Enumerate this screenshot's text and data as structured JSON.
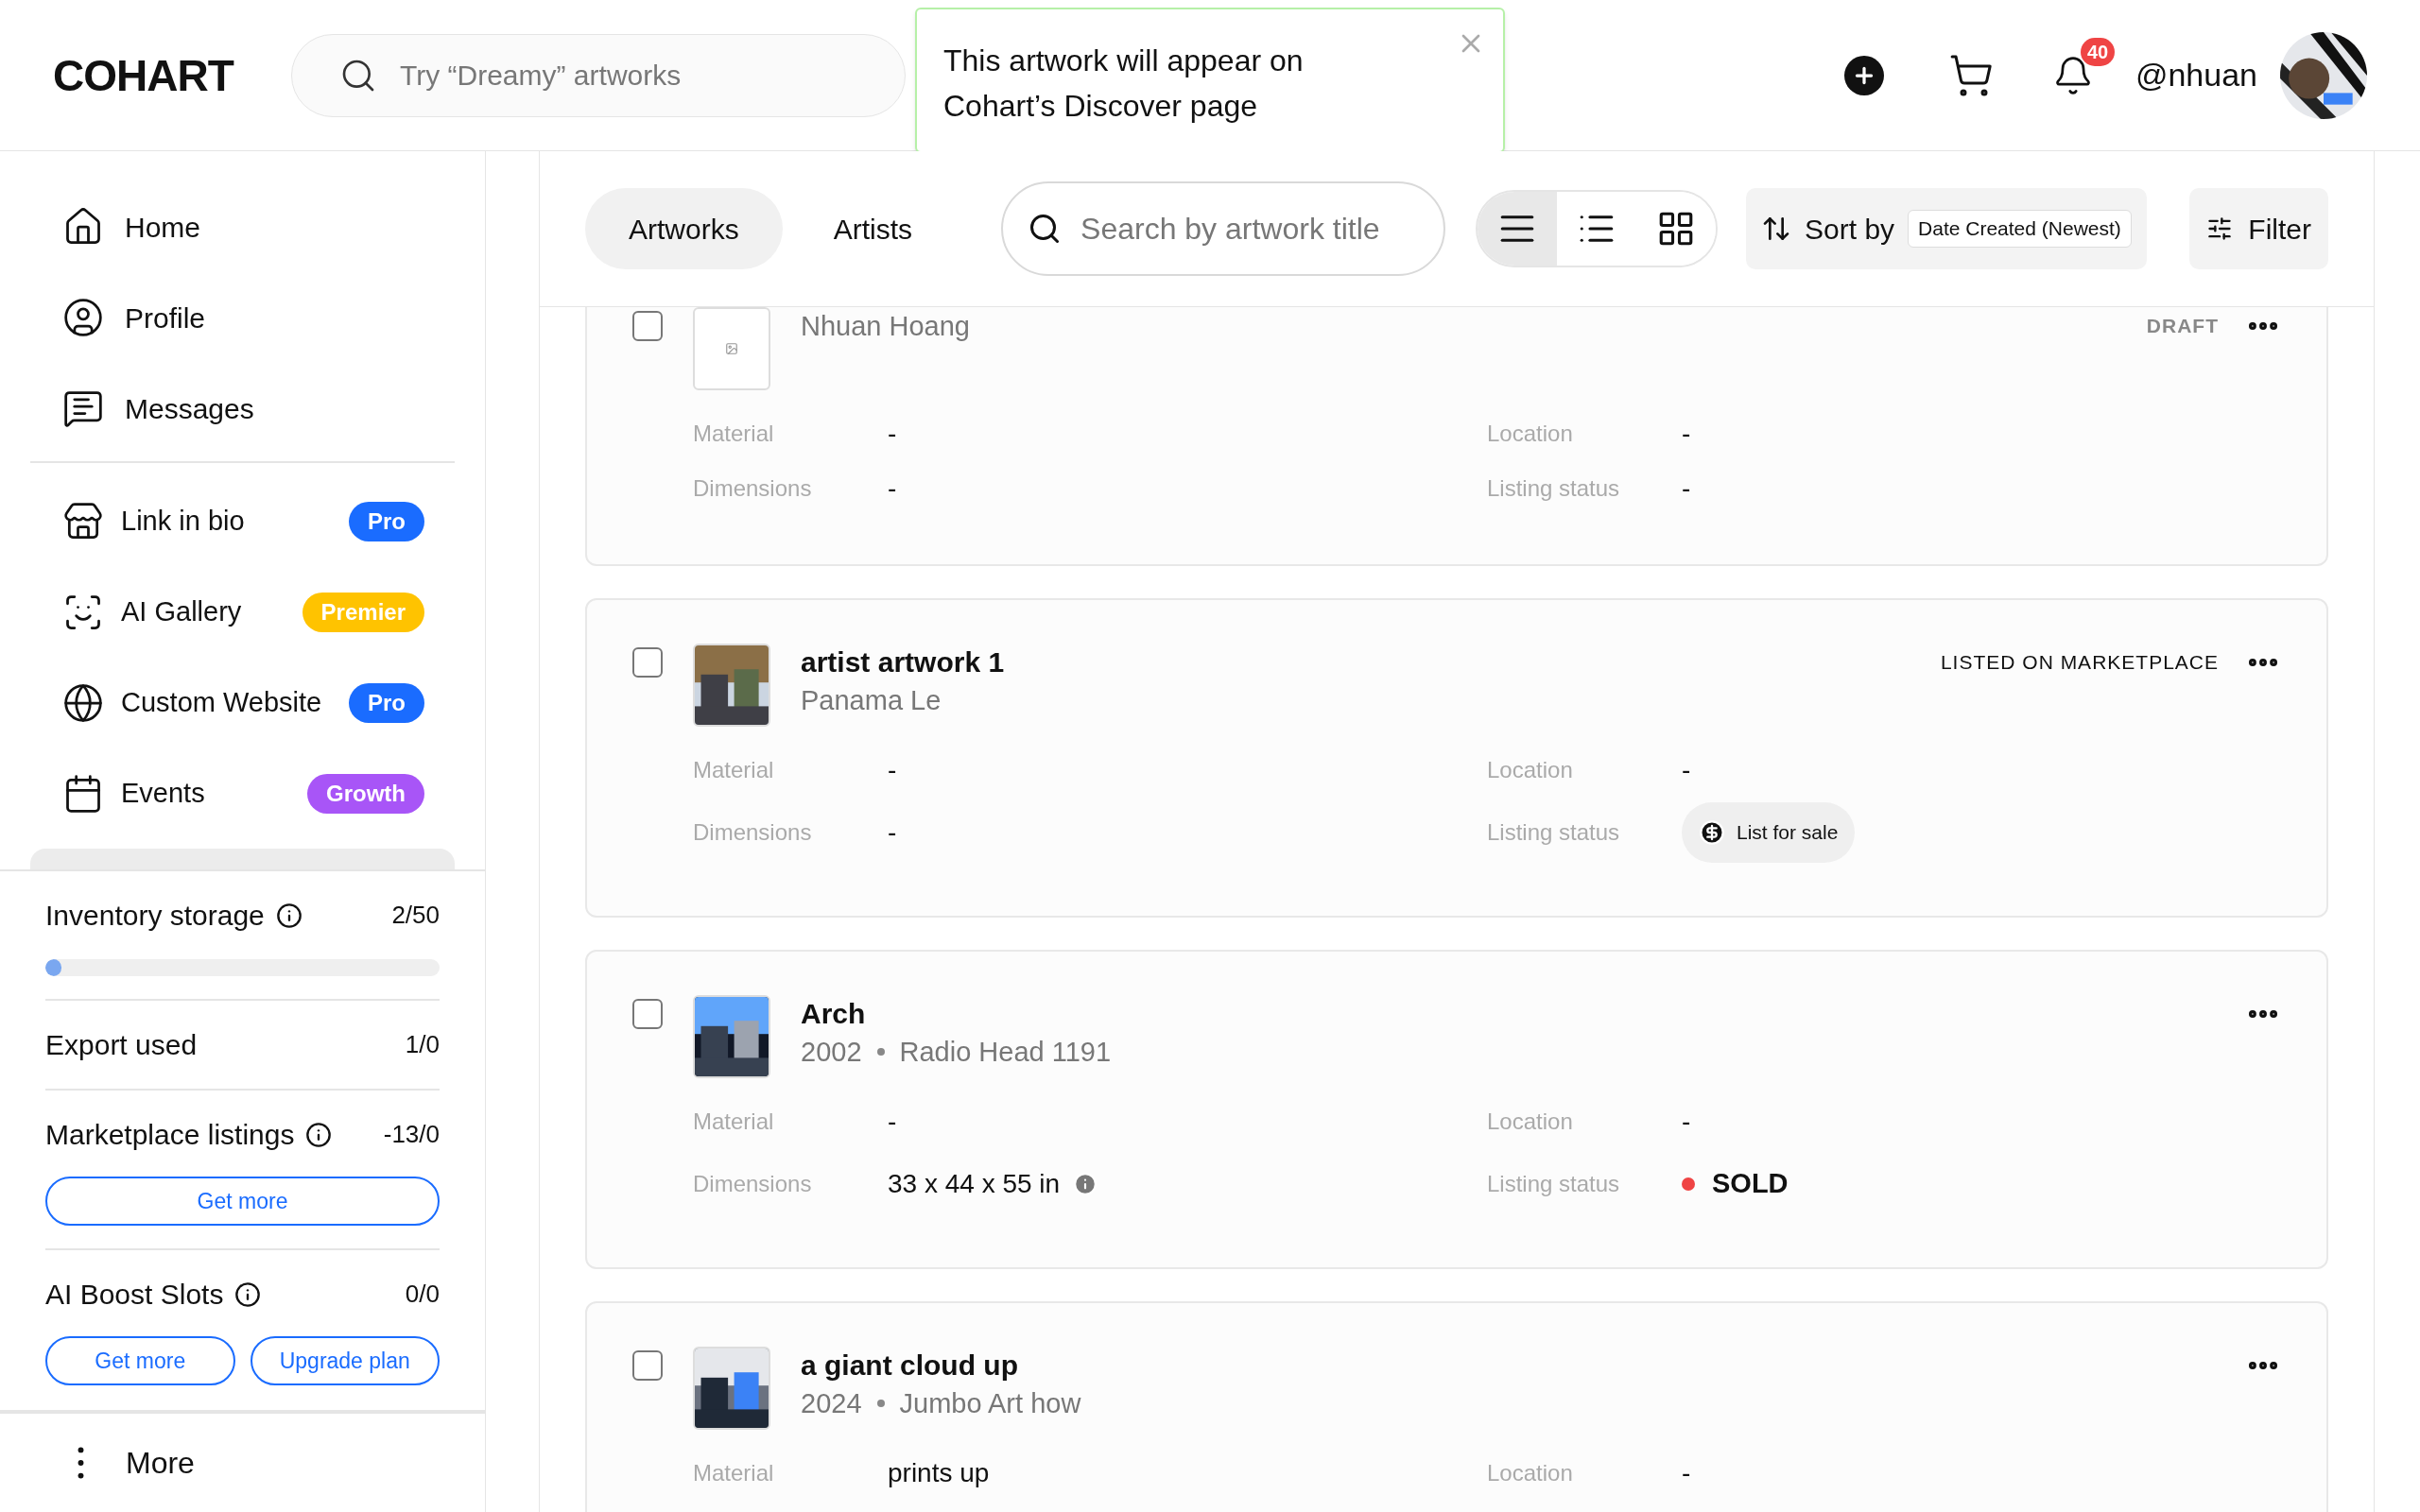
{
  "header": {
    "logo": "COHART",
    "search": {
      "placeholder": "Try “Dreamy” artworks"
    },
    "notifications": "40",
    "username": "@nhuan"
  },
  "toast": {
    "message": "This artwork will appear on Cohart’s Discover page"
  },
  "sidebar": {
    "nav": [
      {
        "label": "Home"
      },
      {
        "label": "Profile"
      },
      {
        "label": "Messages"
      }
    ],
    "features": [
      {
        "label": "Link in bio",
        "badge": "Pro",
        "color": "#1a6cff"
      },
      {
        "label": "AI Gallery",
        "badge": "Premier",
        "color": "#ffc300"
      },
      {
        "label": "Custom Website",
        "badge": "Pro",
        "color": "#1a6cff"
      },
      {
        "label": "Events",
        "badge": "Growth",
        "color": "#a855f7"
      }
    ],
    "usage": [
      {
        "label": "Inventory storage",
        "info": true,
        "value": "2/50",
        "level": 0.04
      },
      {
        "label": "Export used",
        "value": "1/0"
      },
      {
        "label": "Marketplace listings",
        "info": true,
        "value": "-13/0",
        "buttons": [
          "Get more"
        ]
      },
      {
        "label": "AI Boost Slots",
        "info": true,
        "value": "0/0",
        "buttons": [
          "Get more",
          "Upgrade plan"
        ]
      }
    ],
    "more": "More"
  },
  "toolbar": {
    "tabs": [
      {
        "label": "Artworks",
        "selected": true
      },
      {
        "label": "Artists",
        "selected": false
      }
    ],
    "search": {
      "placeholder": "Search by artwork title"
    },
    "views": [
      {
        "selected": true
      },
      {
        "selected": false
      },
      {
        "selected": false
      }
    ],
    "sort_label": "Sort by",
    "sort_value": "Date Created (Newest)",
    "filter": "Filter"
  },
  "artworks": [
    {
      "subtitle": [
        "Nhuan Hoang"
      ],
      "image": {
        "kind": "placeholder"
      },
      "status": {
        "text": "DRAFT",
        "kind": "draft"
      },
      "checked": false,
      "fields": [
        {
          "label": "Material",
          "value": "-"
        },
        {
          "label": "Location",
          "value": "-"
        },
        {
          "label": "Dimensions",
          "value": "-"
        },
        {
          "label": "Listing status",
          "value": "-",
          "kind": "text"
        }
      ]
    },
    {
      "title": "artist artwork 1",
      "subtitle": [
        "Panama Le"
      ],
      "image": {
        "kind": "picture"
      },
      "status": {
        "text": "LISTED ON MARKETPLACE",
        "kind": "listed"
      },
      "checked": false,
      "fields": [
        {
          "label": "Material",
          "value": "-"
        },
        {
          "label": "Location",
          "value": "-"
        },
        {
          "label": "Dimensions",
          "value": "-"
        },
        {
          "label": "Listing status",
          "value": "List for sale",
          "kind": "button"
        }
      ]
    },
    {
      "title": "Arch",
      "subtitle": [
        "2002",
        "Radio Head 1191"
      ],
      "image": {
        "kind": "picture"
      },
      "checked": false,
      "fields": [
        {
          "label": "Material",
          "value": "-"
        },
        {
          "label": "Location",
          "value": "-"
        },
        {
          "label": "Dimensions",
          "value": "33 x 44 x 55 in",
          "info": true
        },
        {
          "label": "Listing status",
          "value": "SOLD",
          "kind": "dot",
          "color": "#ef4444"
        }
      ]
    },
    {
      "title": "a giant cloud up",
      "subtitle": [
        "2024",
        "Jumbo Art how"
      ],
      "image": {
        "kind": "picture"
      },
      "checked": false,
      "fields": [
        {
          "label": "Material",
          "value": "prints up"
        },
        {
          "label": "Location",
          "value": "-"
        }
      ]
    }
  ]
}
